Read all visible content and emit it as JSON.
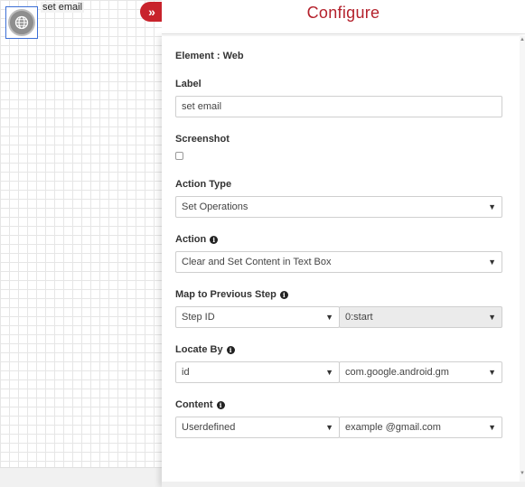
{
  "canvas": {
    "node_label": "set email"
  },
  "header": {
    "title": "Configure",
    "toggle_glyph": "»"
  },
  "form": {
    "element_text": "Element : Web",
    "label": {
      "title": "Label",
      "value": "set email"
    },
    "screenshot": {
      "title": "Screenshot",
      "checked": false
    },
    "action_type": {
      "title": "Action Type",
      "value": "Set Operations"
    },
    "action": {
      "title": "Action",
      "value": "Clear and Set Content in Text Box"
    },
    "map_previous": {
      "title": "Map to Previous Step",
      "left_value": "Step ID",
      "right_value": "0:start"
    },
    "locate_by": {
      "title": "Locate By",
      "left_value": "id",
      "right_value": "com.google.android.gm"
    },
    "content": {
      "title": "Content",
      "left_value": "Userdefined",
      "right_value": "example @gmail.com"
    }
  },
  "icons": {
    "toggle": "double-chevron-right-icon",
    "node": "globe-icon",
    "info": "info-icon",
    "caret": "caret-down-icon"
  },
  "colors": {
    "accent": "#b4212c",
    "toggle_bg": "#c8232c",
    "node_border": "#3c6fd6"
  }
}
